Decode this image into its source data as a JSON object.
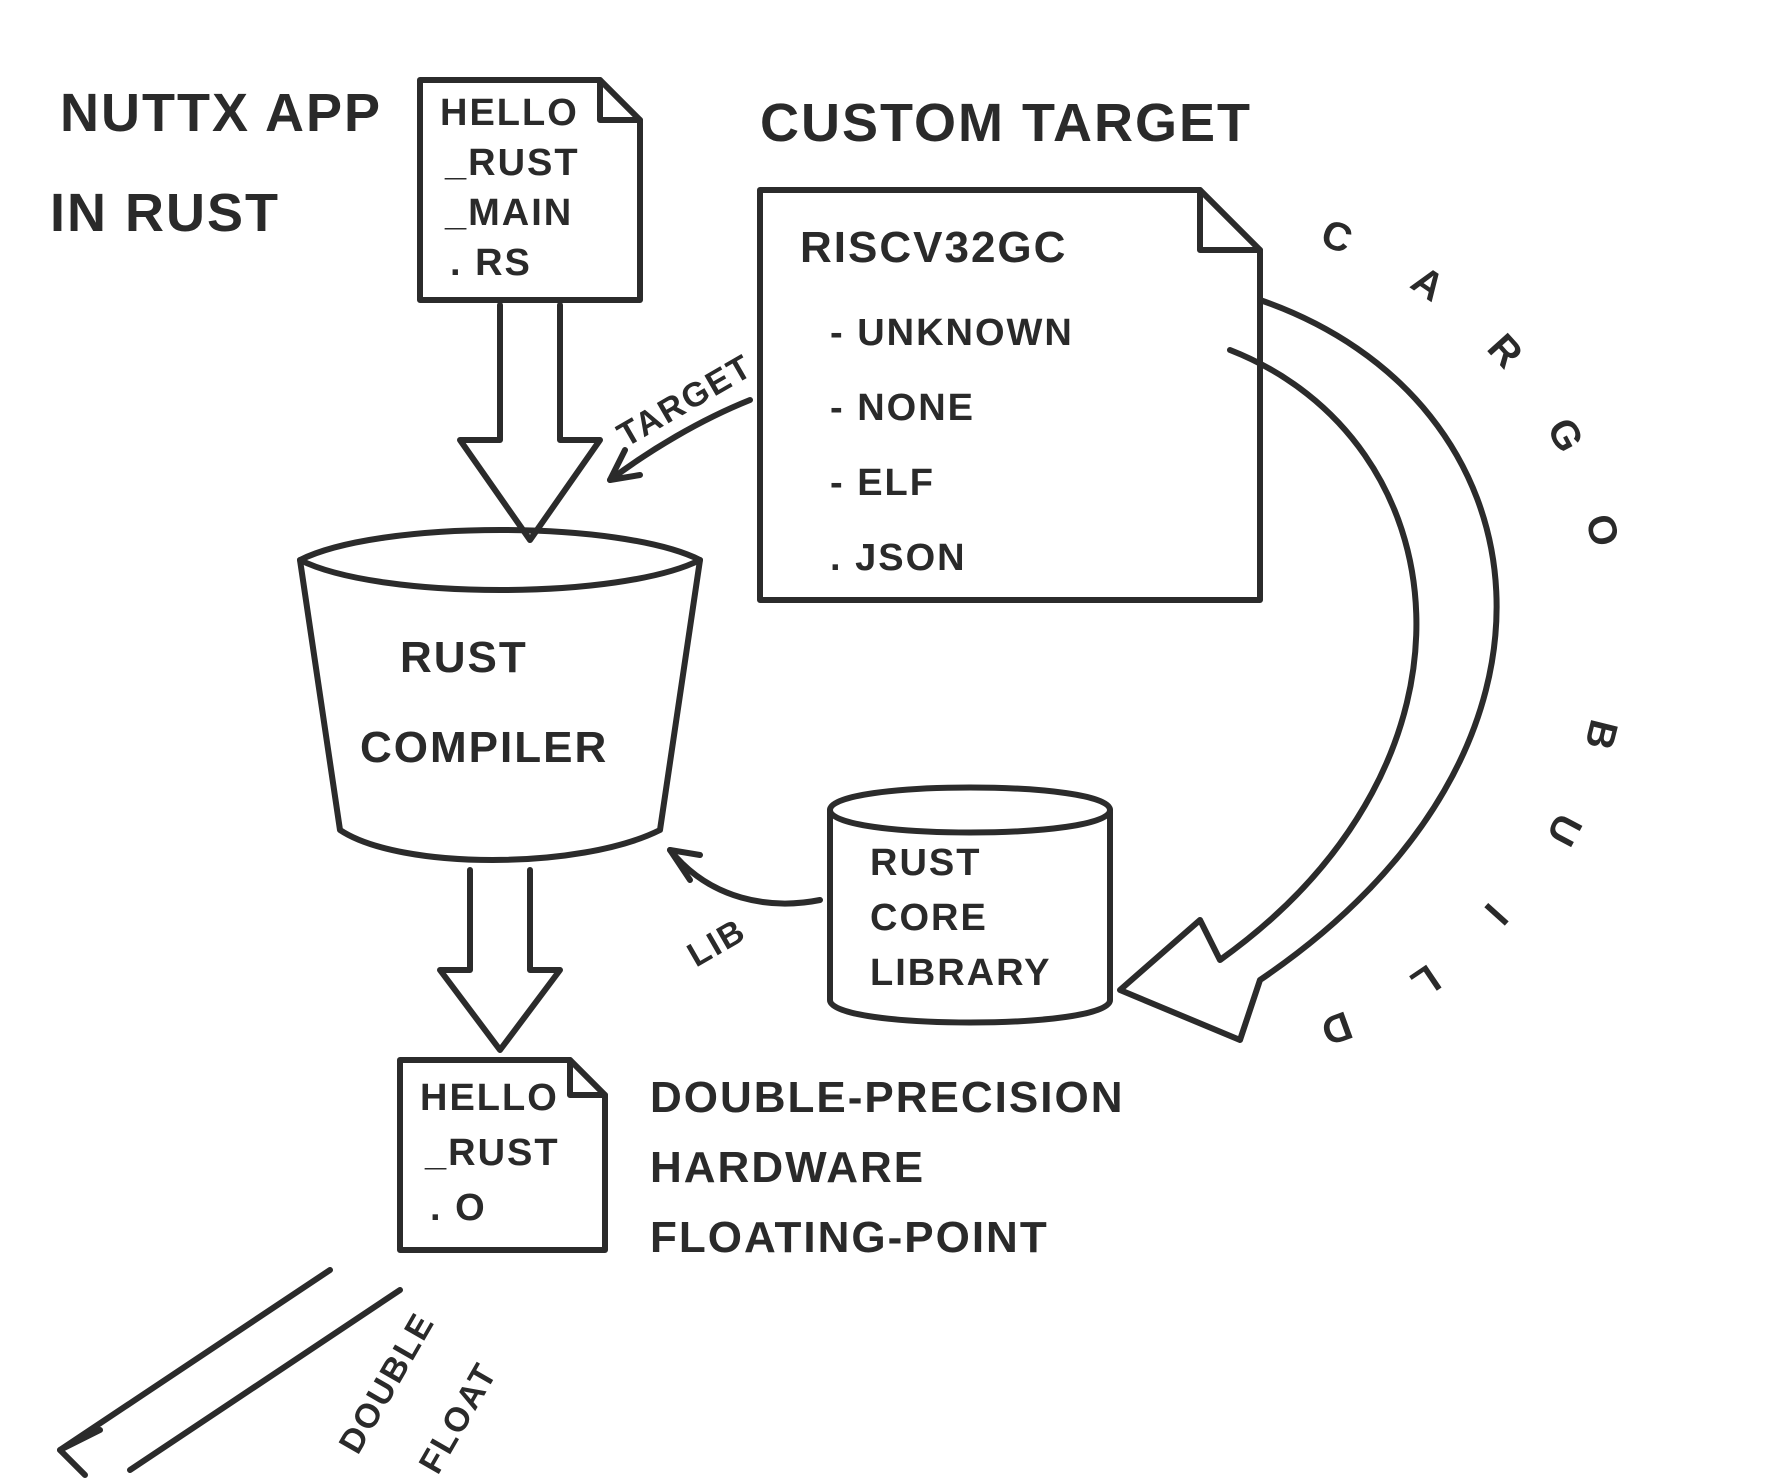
{
  "title": {
    "line1": "NUTTX APP",
    "line2": "IN RUST"
  },
  "custom_target_heading": "CUSTOM TARGET",
  "source_file": {
    "l1": "HELLO",
    "l2": "_RUST",
    "l3": "_MAIN",
    "l4": ". RS"
  },
  "target_file": {
    "l1": "RISCV32GC",
    "items": [
      "- UNKNOWN",
      "- NONE",
      "- ELF",
      ". JSON"
    ]
  },
  "compiler": {
    "l1": "RUST",
    "l2": "COMPILER"
  },
  "core_lib": {
    "l1": "RUST",
    "l2": "CORE",
    "l3": "LIBRARY"
  },
  "output_file": {
    "l1": "HELLO",
    "l2": "_RUST",
    "l3": ". O"
  },
  "notes": {
    "l1": "DOUBLE-PRECISION",
    "l2": "HARDWARE",
    "l3": "FLOATING-POINT"
  },
  "arrows": {
    "target_label": "TARGET",
    "lib_label": "LIB",
    "cargo_build": "CARGO BUILD",
    "double_float_l1": "DOUBLE",
    "double_float_l2": "FLOAT"
  }
}
